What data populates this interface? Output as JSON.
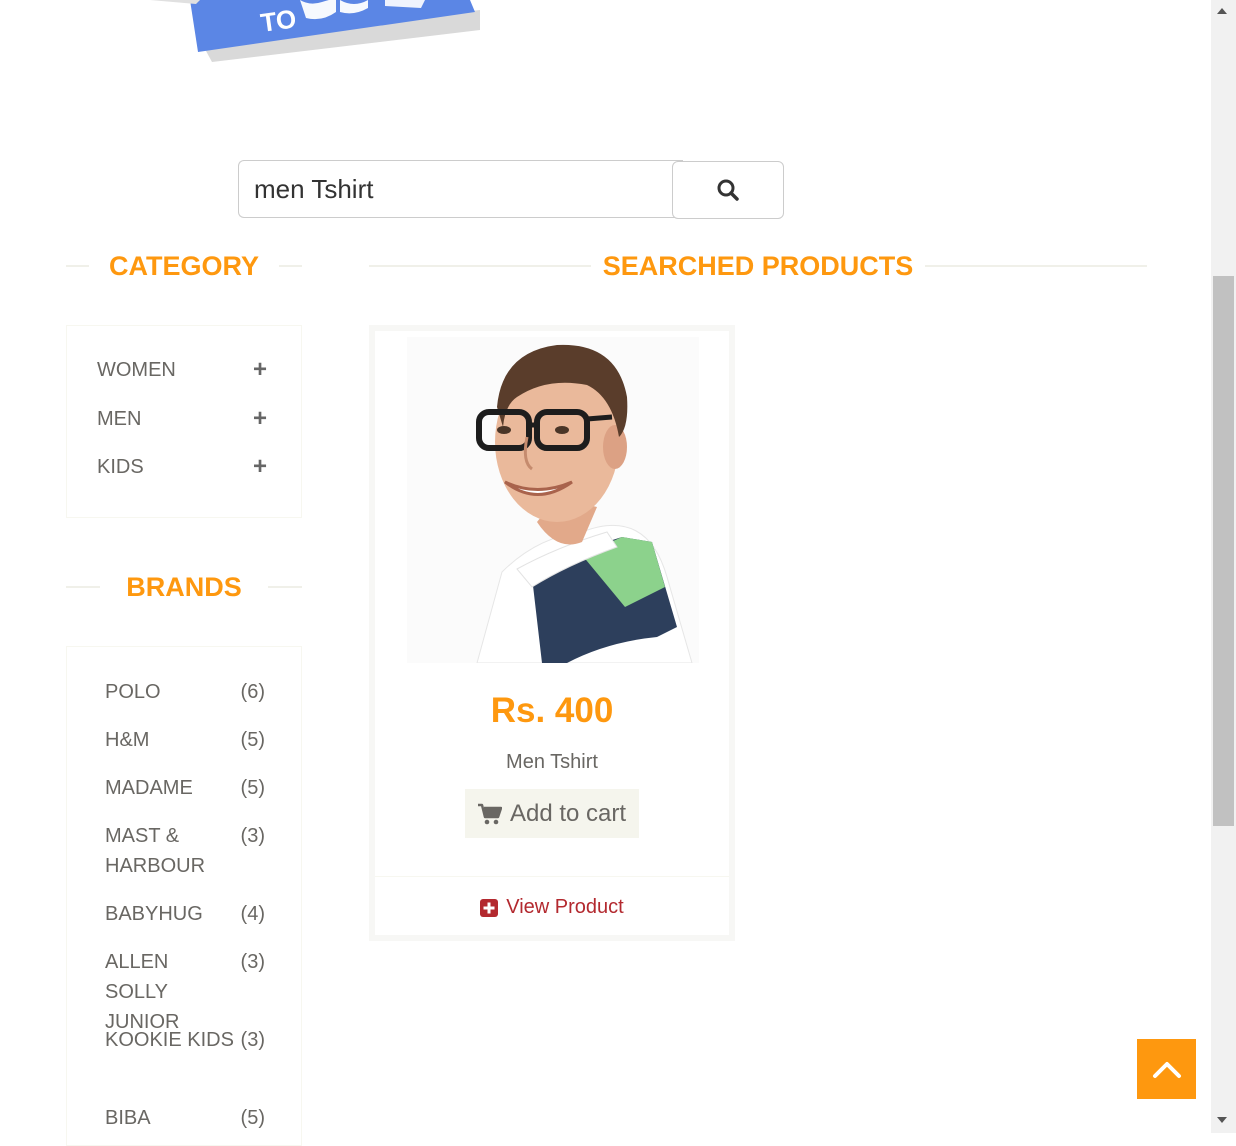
{
  "banner": {
    "text": "TO"
  },
  "search": {
    "value": "men Tshirt",
    "button_icon": "search-icon"
  },
  "category": {
    "title": "CATEGORY",
    "items": [
      {
        "label": "WOMEN",
        "icon": "plus-icon"
      },
      {
        "label": "MEN",
        "icon": "plus-icon"
      },
      {
        "label": "KIDS",
        "icon": "plus-icon"
      }
    ]
  },
  "brands": {
    "title": "BRANDS",
    "items": [
      {
        "name": "POLO",
        "count": "(6)"
      },
      {
        "name": "H&M",
        "count": "(5)"
      },
      {
        "name": "MADAME",
        "count": "(5)"
      },
      {
        "name": "MAST & HARBOUR",
        "count": "(3)"
      },
      {
        "name": "BABYHUG",
        "count": "(4)"
      },
      {
        "name": "ALLEN SOLLY JUNIOR",
        "count": "(3)"
      },
      {
        "name": "KOOKIE KIDS",
        "count": "(3)"
      },
      {
        "name": "BIBA",
        "count": "(5)"
      }
    ]
  },
  "products": {
    "title": "SEARCHED PRODUCTS",
    "items": [
      {
        "price": "Rs. 400",
        "name": "Men Tshirt",
        "add_to_cart": "Add to cart",
        "view_product": "View Product"
      }
    ]
  },
  "colors": {
    "accent": "#fe980f",
    "link": "#b3292f",
    "text": "#696763"
  }
}
